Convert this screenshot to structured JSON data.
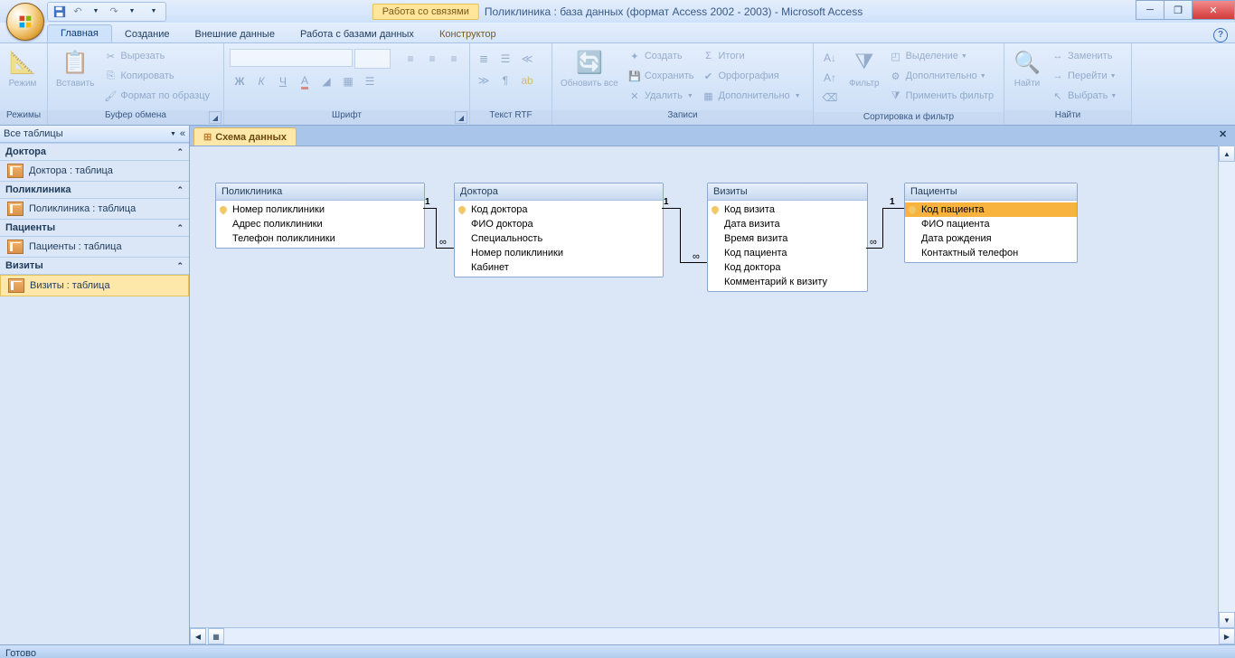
{
  "titlebar": {
    "context_label": "Работа со связями",
    "window_title": "Поликлиника : база данных (формат Access 2002 - 2003) - Microsoft Access"
  },
  "tabs": {
    "home": "Главная",
    "create": "Создание",
    "external": "Внешние данные",
    "dbtools": "Работа с базами данных",
    "constructor": "Конструктор"
  },
  "ribbon": {
    "modes_group": "Режимы",
    "mode_btn": "Режим",
    "clipboard_group": "Буфер обмена",
    "paste": "Вставить",
    "cut": "Вырезать",
    "copy": "Копировать",
    "format_painter": "Формат по образцу",
    "font_group": "Шрифт",
    "bold": "Ж",
    "italic": "К",
    "underline": "Ч",
    "richtext_group": "Текст RTF",
    "records_group": "Записи",
    "refresh": "Обновить все",
    "new": "Создать",
    "save": "Сохранить",
    "delete": "Удалить",
    "totals": "Итоги",
    "spelling": "Орфография",
    "more": "Дополнительно",
    "sort_group": "Сортировка и фильтр",
    "filter": "Фильтр",
    "selection": "Выделение",
    "advanced": "Дополнительно",
    "toggle": "Применить фильтр",
    "find_group": "Найти",
    "find": "Найти",
    "replace": "Заменить",
    "goto": "Перейти",
    "select": "Выбрать"
  },
  "nav": {
    "header": "Все таблицы",
    "groups": [
      {
        "name": "Доктора",
        "items": [
          "Доктора : таблица"
        ]
      },
      {
        "name": "Поликлиника",
        "items": [
          "Поликлиника : таблица"
        ]
      },
      {
        "name": "Пациенты",
        "items": [
          "Пациенты : таблица"
        ]
      },
      {
        "name": "Визиты",
        "items": [
          "Визиты : таблица"
        ]
      }
    ]
  },
  "doc_tab": "Схема данных",
  "tables": {
    "poliklinika": {
      "title": "Поликлиника",
      "fields": [
        "Номер поликлиники",
        "Адрес поликлиники",
        "Телефон поликлиники"
      ],
      "key": 0
    },
    "doktora": {
      "title": "Доктора",
      "fields": [
        "Код доктора",
        "ФИО доктора",
        "Специальность",
        "Номер поликлиники",
        "Кабинет"
      ],
      "key": 0
    },
    "vizity": {
      "title": "Визиты",
      "fields": [
        "Код визита",
        "Дата визита",
        "Время визита",
        "Код пациента",
        "Код доктора",
        "Комментарий к визиту"
      ],
      "key": 0
    },
    "pacienty": {
      "title": "Пациенты",
      "fields": [
        "Код пациента",
        "ФИО пациента",
        "Дата рождения",
        "Контактный телефон"
      ],
      "key": 0,
      "selected": 0
    }
  },
  "rel_one": "1",
  "rel_inf": "∞",
  "status": "Готово"
}
